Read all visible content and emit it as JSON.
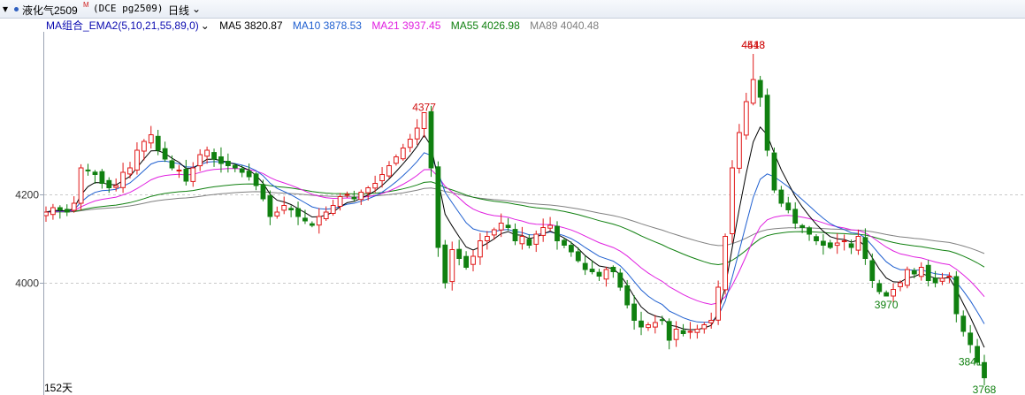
{
  "header": {
    "symbol_name": "液化气2509",
    "symbol_badge": "M",
    "symbol_code": "(DCE pg2509)",
    "period": "日线"
  },
  "indicator": {
    "name": "MA组合_EMA2(5,10,21,55,89,0)",
    "ma5": "MA5 3820.87",
    "ma10": "MA10 3878.53",
    "ma21": "MA21 3937.45",
    "ma55": "MA55 4026.98",
    "ma89": "MA89 4040.48",
    "colors": {
      "ma5": "#000000",
      "ma10": "#2060d0",
      "ma21": "#e020e0",
      "ma55": "#108010",
      "ma89": "#808080"
    }
  },
  "footer": {
    "days": "152天"
  },
  "chart_data": {
    "type": "candlestick",
    "ylim": [
      3760,
      4560
    ],
    "yticks": [
      4000,
      4200
    ],
    "grid": "dashed horizontal",
    "annotations": [
      {
        "text": "4377",
        "value": 4377,
        "kind": "high"
      },
      {
        "text": "4443",
        "value": 4443,
        "kind": "high"
      },
      {
        "text": "3970",
        "value": 3970,
        "kind": "low"
      },
      {
        "text": "4518",
        "value": 4518,
        "kind": "high"
      },
      {
        "text": "3841",
        "value": 3841,
        "kind": "low"
      },
      {
        "text": "3768",
        "value": 3768,
        "kind": "low"
      }
    ],
    "closes": [
      4160,
      4170,
      4165,
      4160,
      4180,
      4260,
      4255,
      4245,
      4225,
      4215,
      4220,
      4250,
      4260,
      4300,
      4320,
      4335,
      4300,
      4280,
      4260,
      4255,
      4230,
      4260,
      4290,
      4300,
      4280,
      4270,
      4265,
      4260,
      4250,
      4240,
      4220,
      4190,
      4150,
      4160,
      4175,
      4165,
      4150,
      4140,
      4130,
      4150,
      4160,
      4175,
      4195,
      4200,
      4190,
      4205,
      4215,
      4225,
      4245,
      4265,
      4285,
      4305,
      4325,
      4350,
      4385,
      4260,
      4080,
      4000,
      4075,
      4055,
      4035,
      4060,
      4095,
      4105,
      4120,
      4135,
      4125,
      4095,
      4105,
      4085,
      4110,
      4125,
      4130,
      4095,
      4085,
      4070,
      4050,
      4030,
      4025,
      4015,
      4030,
      4025,
      3990,
      3950,
      3915,
      3900,
      3905,
      3910,
      3915,
      3870,
      3895,
      3885,
      3890,
      3895,
      3905,
      3915,
      3990,
      4105,
      4260,
      4340,
      4410,
      4460,
      4420,
      4300,
      4210,
      4180,
      4165,
      4135,
      4125,
      4110,
      4095,
      4085,
      4080,
      4090,
      4095,
      4080,
      4105,
      4055,
      4005,
      3980,
      3970,
      3985,
      4000,
      4030,
      4020,
      4035,
      4005,
      4000,
      4010,
      4015,
      3930,
      3890,
      3860,
      3820,
      3785
    ]
  }
}
